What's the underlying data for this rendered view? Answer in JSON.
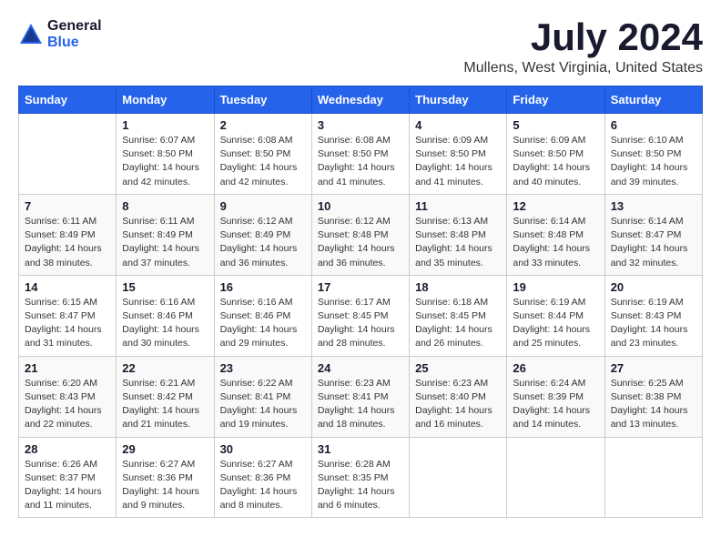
{
  "logo": {
    "general": "General",
    "blue": "Blue"
  },
  "title": "July 2024",
  "subtitle": "Mullens, West Virginia, United States",
  "weekdays": [
    "Sunday",
    "Monday",
    "Tuesday",
    "Wednesday",
    "Thursday",
    "Friday",
    "Saturday"
  ],
  "weeks": [
    [
      {
        "day": "",
        "sunrise": "",
        "sunset": "",
        "daylight": ""
      },
      {
        "day": "1",
        "sunrise": "Sunrise: 6:07 AM",
        "sunset": "Sunset: 8:50 PM",
        "daylight": "Daylight: 14 hours and 42 minutes."
      },
      {
        "day": "2",
        "sunrise": "Sunrise: 6:08 AM",
        "sunset": "Sunset: 8:50 PM",
        "daylight": "Daylight: 14 hours and 42 minutes."
      },
      {
        "day": "3",
        "sunrise": "Sunrise: 6:08 AM",
        "sunset": "Sunset: 8:50 PM",
        "daylight": "Daylight: 14 hours and 41 minutes."
      },
      {
        "day": "4",
        "sunrise": "Sunrise: 6:09 AM",
        "sunset": "Sunset: 8:50 PM",
        "daylight": "Daylight: 14 hours and 41 minutes."
      },
      {
        "day": "5",
        "sunrise": "Sunrise: 6:09 AM",
        "sunset": "Sunset: 8:50 PM",
        "daylight": "Daylight: 14 hours and 40 minutes."
      },
      {
        "day": "6",
        "sunrise": "Sunrise: 6:10 AM",
        "sunset": "Sunset: 8:50 PM",
        "daylight": "Daylight: 14 hours and 39 minutes."
      }
    ],
    [
      {
        "day": "7",
        "sunrise": "Sunrise: 6:11 AM",
        "sunset": "Sunset: 8:49 PM",
        "daylight": "Daylight: 14 hours and 38 minutes."
      },
      {
        "day": "8",
        "sunrise": "Sunrise: 6:11 AM",
        "sunset": "Sunset: 8:49 PM",
        "daylight": "Daylight: 14 hours and 37 minutes."
      },
      {
        "day": "9",
        "sunrise": "Sunrise: 6:12 AM",
        "sunset": "Sunset: 8:49 PM",
        "daylight": "Daylight: 14 hours and 36 minutes."
      },
      {
        "day": "10",
        "sunrise": "Sunrise: 6:12 AM",
        "sunset": "Sunset: 8:48 PM",
        "daylight": "Daylight: 14 hours and 36 minutes."
      },
      {
        "day": "11",
        "sunrise": "Sunrise: 6:13 AM",
        "sunset": "Sunset: 8:48 PM",
        "daylight": "Daylight: 14 hours and 35 minutes."
      },
      {
        "day": "12",
        "sunrise": "Sunrise: 6:14 AM",
        "sunset": "Sunset: 8:48 PM",
        "daylight": "Daylight: 14 hours and 33 minutes."
      },
      {
        "day": "13",
        "sunrise": "Sunrise: 6:14 AM",
        "sunset": "Sunset: 8:47 PM",
        "daylight": "Daylight: 14 hours and 32 minutes."
      }
    ],
    [
      {
        "day": "14",
        "sunrise": "Sunrise: 6:15 AM",
        "sunset": "Sunset: 8:47 PM",
        "daylight": "Daylight: 14 hours and 31 minutes."
      },
      {
        "day": "15",
        "sunrise": "Sunrise: 6:16 AM",
        "sunset": "Sunset: 8:46 PM",
        "daylight": "Daylight: 14 hours and 30 minutes."
      },
      {
        "day": "16",
        "sunrise": "Sunrise: 6:16 AM",
        "sunset": "Sunset: 8:46 PM",
        "daylight": "Daylight: 14 hours and 29 minutes."
      },
      {
        "day": "17",
        "sunrise": "Sunrise: 6:17 AM",
        "sunset": "Sunset: 8:45 PM",
        "daylight": "Daylight: 14 hours and 28 minutes."
      },
      {
        "day": "18",
        "sunrise": "Sunrise: 6:18 AM",
        "sunset": "Sunset: 8:45 PM",
        "daylight": "Daylight: 14 hours and 26 minutes."
      },
      {
        "day": "19",
        "sunrise": "Sunrise: 6:19 AM",
        "sunset": "Sunset: 8:44 PM",
        "daylight": "Daylight: 14 hours and 25 minutes."
      },
      {
        "day": "20",
        "sunrise": "Sunrise: 6:19 AM",
        "sunset": "Sunset: 8:43 PM",
        "daylight": "Daylight: 14 hours and 23 minutes."
      }
    ],
    [
      {
        "day": "21",
        "sunrise": "Sunrise: 6:20 AM",
        "sunset": "Sunset: 8:43 PM",
        "daylight": "Daylight: 14 hours and 22 minutes."
      },
      {
        "day": "22",
        "sunrise": "Sunrise: 6:21 AM",
        "sunset": "Sunset: 8:42 PM",
        "daylight": "Daylight: 14 hours and 21 minutes."
      },
      {
        "day": "23",
        "sunrise": "Sunrise: 6:22 AM",
        "sunset": "Sunset: 8:41 PM",
        "daylight": "Daylight: 14 hours and 19 minutes."
      },
      {
        "day": "24",
        "sunrise": "Sunrise: 6:23 AM",
        "sunset": "Sunset: 8:41 PM",
        "daylight": "Daylight: 14 hours and 18 minutes."
      },
      {
        "day": "25",
        "sunrise": "Sunrise: 6:23 AM",
        "sunset": "Sunset: 8:40 PM",
        "daylight": "Daylight: 14 hours and 16 minutes."
      },
      {
        "day": "26",
        "sunrise": "Sunrise: 6:24 AM",
        "sunset": "Sunset: 8:39 PM",
        "daylight": "Daylight: 14 hours and 14 minutes."
      },
      {
        "day": "27",
        "sunrise": "Sunrise: 6:25 AM",
        "sunset": "Sunset: 8:38 PM",
        "daylight": "Daylight: 14 hours and 13 minutes."
      }
    ],
    [
      {
        "day": "28",
        "sunrise": "Sunrise: 6:26 AM",
        "sunset": "Sunset: 8:37 PM",
        "daylight": "Daylight: 14 hours and 11 minutes."
      },
      {
        "day": "29",
        "sunrise": "Sunrise: 6:27 AM",
        "sunset": "Sunset: 8:36 PM",
        "daylight": "Daylight: 14 hours and 9 minutes."
      },
      {
        "day": "30",
        "sunrise": "Sunrise: 6:27 AM",
        "sunset": "Sunset: 8:36 PM",
        "daylight": "Daylight: 14 hours and 8 minutes."
      },
      {
        "day": "31",
        "sunrise": "Sunrise: 6:28 AM",
        "sunset": "Sunset: 8:35 PM",
        "daylight": "Daylight: 14 hours and 6 minutes."
      },
      {
        "day": "",
        "sunrise": "",
        "sunset": "",
        "daylight": ""
      },
      {
        "day": "",
        "sunrise": "",
        "sunset": "",
        "daylight": ""
      },
      {
        "day": "",
        "sunrise": "",
        "sunset": "",
        "daylight": ""
      }
    ]
  ]
}
